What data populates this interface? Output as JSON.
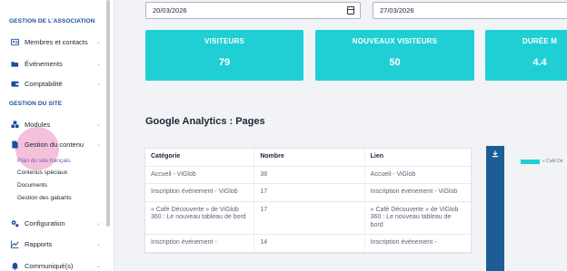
{
  "sidebar": {
    "sections": [
      {
        "title": "GESTION DE L'ASSOCIATION"
      },
      {
        "title": "GESTION DU SITE"
      }
    ],
    "items": [
      {
        "label": "Membres et contacts",
        "icon": "id-card-icon"
      },
      {
        "label": "Événements",
        "icon": "folder-open-icon"
      },
      {
        "label": "Comptabilité",
        "icon": "wallet-icon"
      },
      {
        "label": "Modules",
        "icon": "cubes-icon"
      },
      {
        "label": "Gestion du contenu",
        "icon": "file-icon"
      },
      {
        "label": "Configuration",
        "icon": "cogs-icon"
      },
      {
        "label": "Rapports",
        "icon": "line-chart-icon"
      },
      {
        "label": "Communiqué(s)",
        "icon": "bell-icon"
      }
    ],
    "sub_items": [
      {
        "label": "Plan du site français",
        "active": true
      },
      {
        "label": "Contenus spéciaux"
      },
      {
        "label": "Documents"
      },
      {
        "label": "Gestion des gabarits"
      }
    ]
  },
  "filters": {
    "start_date": "20/03/2026",
    "end_date": "27/03/2026"
  },
  "stats": [
    {
      "title": "VISITEURS",
      "value": "79"
    },
    {
      "title": "NOUVEAUX VISITEURS",
      "value": "50"
    },
    {
      "title": "DURÉE M",
      "value": "4.4"
    }
  ],
  "pages_section": {
    "title": "Google Analytics : Pages",
    "columns": [
      "Catégorie",
      "Nombre",
      "Lien"
    ],
    "rows": [
      [
        "Accueil - ViGlob",
        "38",
        "Accueil - ViGlob"
      ],
      [
        "Inscription événement - ViGlob",
        "17",
        "Inscription événement - ViGlob"
      ],
      [
        "« Café Découverte » de ViGlob 360 : Le nouveau tableau de bord",
        "17",
        "« Café Découverte » de ViGlob 360 : Le nouveau tableau de bord"
      ],
      [
        "Inscription événement -",
        "14",
        "Inscription événement -"
      ]
    ]
  },
  "chart_legend": {
    "label": "« Café Dé"
  },
  "colors": {
    "accent": "#1fcfd4",
    "sidebar_heading": "#1b4f9c",
    "download_bar": "#1d5d95"
  }
}
